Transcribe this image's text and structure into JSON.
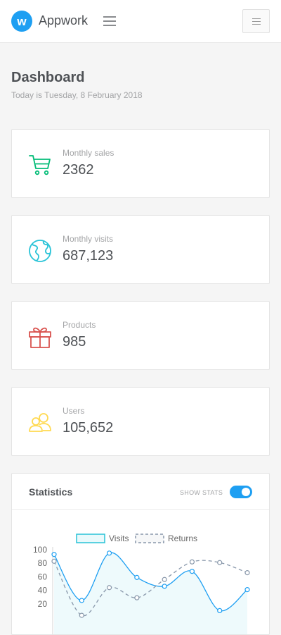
{
  "app": {
    "brand": "Appwork",
    "logo_letter": "w"
  },
  "page": {
    "title": "Dashboard",
    "subtitle": "Today is Tuesday, 8 February 2018"
  },
  "cards": [
    {
      "label": "Monthly sales",
      "value": "2362",
      "icon": "cart-icon",
      "color": "#02bc77"
    },
    {
      "label": "Monthly visits",
      "value": "687,123",
      "icon": "globe-icon",
      "color": "#28c3d7"
    },
    {
      "label": "Products",
      "value": "985",
      "icon": "gift-icon",
      "color": "#d9534f"
    },
    {
      "label": "Users",
      "value": "105,652",
      "icon": "users-icon",
      "color": "#ffd950"
    }
  ],
  "statistics": {
    "title": "Statistics",
    "toggle_label": "SHOW STATS",
    "toggle_on": true
  },
  "chart_data": {
    "type": "line",
    "x": [
      1,
      2,
      3,
      4,
      5,
      6,
      7,
      8
    ],
    "series": [
      {
        "name": "Visits",
        "values": [
          93,
          25,
          95,
          59,
          46,
          68,
          10,
          41
        ],
        "color": "#1e9ff2",
        "fill": "rgba(40,195,215,0.08)"
      },
      {
        "name": "Returns",
        "values": [
          83,
          3,
          44,
          29,
          56,
          82,
          81,
          66
        ],
        "color": "#8897aa",
        "dashed": true
      }
    ],
    "ylim": [
      0,
      100
    ],
    "yticks": [
      "100",
      "80",
      "60",
      "40",
      "20"
    ],
    "legend": "top"
  }
}
